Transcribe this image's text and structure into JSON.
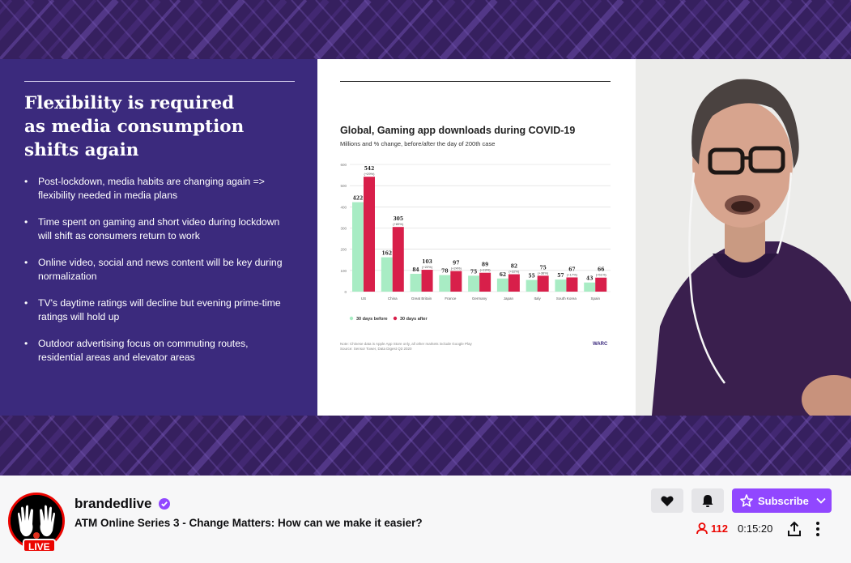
{
  "slide": {
    "title": "Flexibility is required\nas media consumption\nshifts again",
    "bullets": [
      "Post-lockdown, media habits are changing again => flexibility needed in media plans",
      "Time spent on gaming and short video during lockdown will shift as consumers return to work",
      "Online video, social and news content will be key during normalization",
      "TV's daytime ratings will decline but evening prime-time ratings will hold up",
      "Outdoor advertising focus on commuting routes, residential areas and elevator areas"
    ]
  },
  "chart_data": {
    "type": "bar",
    "title": "Global, Gaming app downloads during COVID-19",
    "subtitle": "Millions and % change, before/after the day of 200th case",
    "categories": [
      "US",
      "China",
      "Great Britain",
      "France",
      "Germany",
      "Japan",
      "Italy",
      "South Korea",
      "Spain"
    ],
    "series": [
      {
        "name": "30 days before",
        "color": "#a8ecc4",
        "values": [
          422,
          162,
          84,
          78,
          75,
          62,
          55,
          57,
          43
        ]
      },
      {
        "name": "30 days after",
        "color": "#d81f4a",
        "values": [
          542,
          305,
          103,
          97,
          89,
          82,
          75,
          67,
          66
        ]
      }
    ],
    "change_labels": [
      "(+29%)",
      "(+89%)",
      "(+22%)",
      "(+24%)",
      "(+19%)",
      "(+32%)",
      "(+36%)",
      "(+17%)",
      "(+51%)"
    ],
    "yticks": [
      0,
      100,
      200,
      300,
      400,
      500,
      600
    ],
    "ylim": [
      0,
      600
    ],
    "grid": true,
    "legend": "bottom-left",
    "note": "Note: Chinese data is Apple App Store only, all other markets include Google Play\nSource: Sensor Tower, Data Digest Q3 2020",
    "logo": "WARC"
  },
  "channel": {
    "name": "brandedlive",
    "live_label": "LIVE",
    "stream_title": "ATM Online Series 3 - Change Matters: How can we make it easier?",
    "viewer_count": "112",
    "uptime": "0:15:20"
  },
  "actions": {
    "subscribe_label": "Subscribe"
  },
  "colors": {
    "accent": "#9147ff",
    "live": "#eb0400",
    "slide_panel": "#3b2a7d"
  }
}
